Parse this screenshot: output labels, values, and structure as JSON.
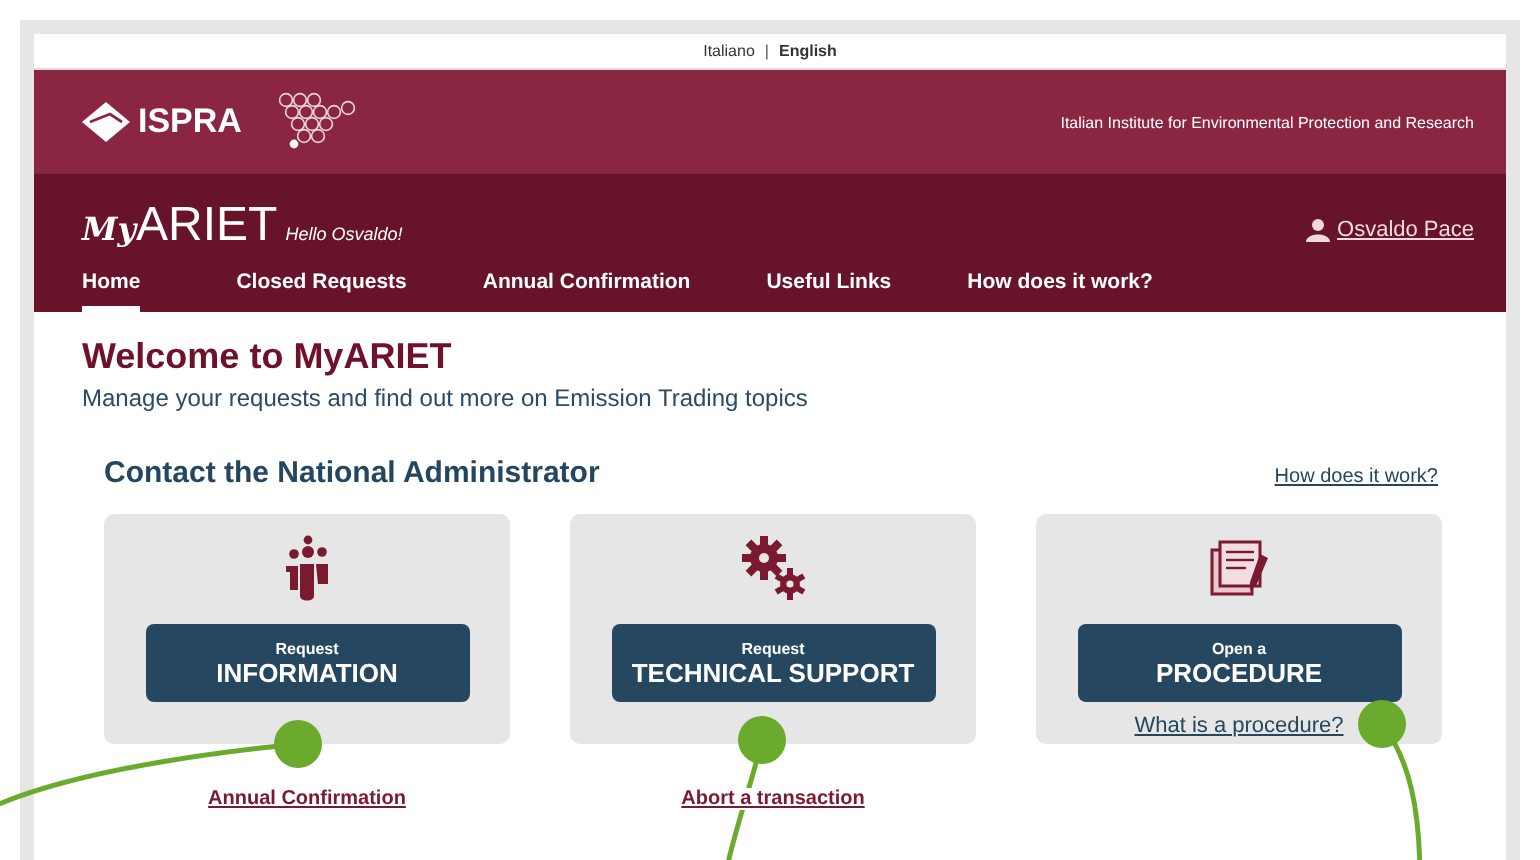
{
  "language_separator": "|",
  "languages": [
    {
      "label": "Italiano",
      "selected": false
    },
    {
      "label": "English",
      "selected": true
    }
  ],
  "header": {
    "logo_text": "ISPRA",
    "institute": "Italian Institute for Environmental Protection and Research",
    "app_prefix": "My",
    "app_name": "ARIET",
    "greeting": "Hello Osvaldo!",
    "user": "Osvaldo Pace"
  },
  "nav": [
    {
      "label": "Home",
      "selected": true
    },
    {
      "label": "Closed Requests",
      "selected": false
    },
    {
      "label": "Annual Confirmation",
      "selected": false
    },
    {
      "label": "Useful Links",
      "selected": false
    },
    {
      "label": "How does it work?",
      "selected": false
    }
  ],
  "welcome": {
    "title": "Welcome to MyARIET",
    "subtitle": "Manage your requests and find out more on Emission Trading topics"
  },
  "contact": {
    "title": "Contact the National Administrator",
    "help_link": "How does it work?"
  },
  "cards": [
    {
      "kind": "info",
      "button_small": "Request",
      "button_big": "INFORMATION",
      "annotated": true,
      "below_link": "Annual Confirmation"
    },
    {
      "kind": "support",
      "button_small": "Request",
      "button_big": "TECHNICAL SUPPORT",
      "annotated": true,
      "below_link": "Abort a transaction"
    },
    {
      "kind": "procedure",
      "button_small": "Open a",
      "button_big": "PROCEDURE",
      "annotated": true,
      "inner_link": "What is a procedure?"
    }
  ]
}
